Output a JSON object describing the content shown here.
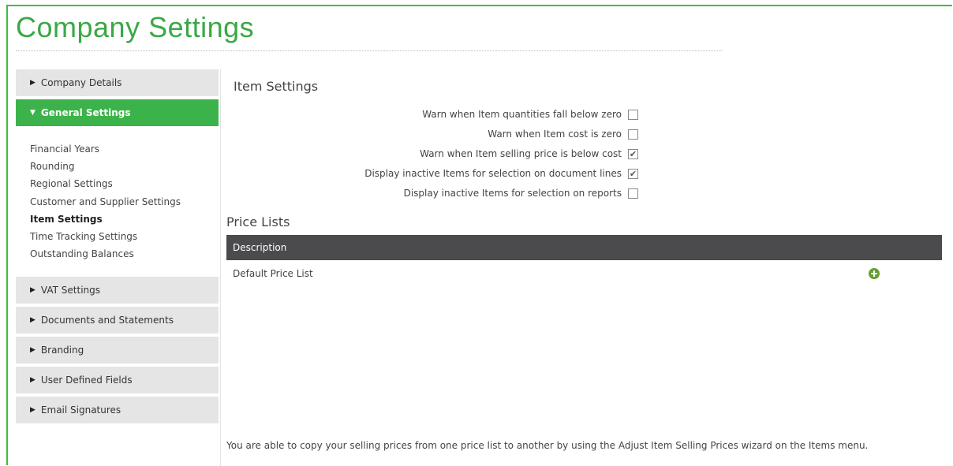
{
  "page": {
    "title": "Company Settings"
  },
  "sidebar": {
    "company_details": "Company Details",
    "general_settings": "General Settings",
    "sub_items": [
      "Financial Years",
      "Rounding",
      "Regional Settings",
      "Customer and Supplier Settings",
      "Item Settings",
      "Time Tracking Settings",
      "Outstanding Balances"
    ],
    "vat_settings": "VAT Settings",
    "documents_statements": "Documents and Statements",
    "branding": "Branding",
    "user_defined_fields": "User Defined Fields",
    "email_signatures": "Email Signatures",
    "active_sub_item": "Item Settings"
  },
  "item_settings": {
    "title": "Item Settings",
    "options": [
      {
        "label": "Warn when Item quantities fall below zero",
        "checked": false
      },
      {
        "label": "Warn when Item cost is zero",
        "checked": false
      },
      {
        "label": "Warn when Item selling price is below cost",
        "checked": true
      },
      {
        "label": "Display inactive Items for selection on document lines",
        "checked": true
      },
      {
        "label": "Display inactive Items for selection on reports",
        "checked": false
      }
    ]
  },
  "price_lists": {
    "title": "Price Lists",
    "column_description": "Description",
    "rows": [
      "Default Price List"
    ],
    "add_icon": "plus-circle-icon",
    "add_icon_color": "#62a033"
  },
  "footer_note": "You are able to copy your selling prices from one price list to another by using the Adjust Item Selling Prices wizard on the Items menu.",
  "colors": {
    "accent": "#3cb34a",
    "header_dark": "#4b4b4d",
    "title_green": "#3aa845"
  }
}
